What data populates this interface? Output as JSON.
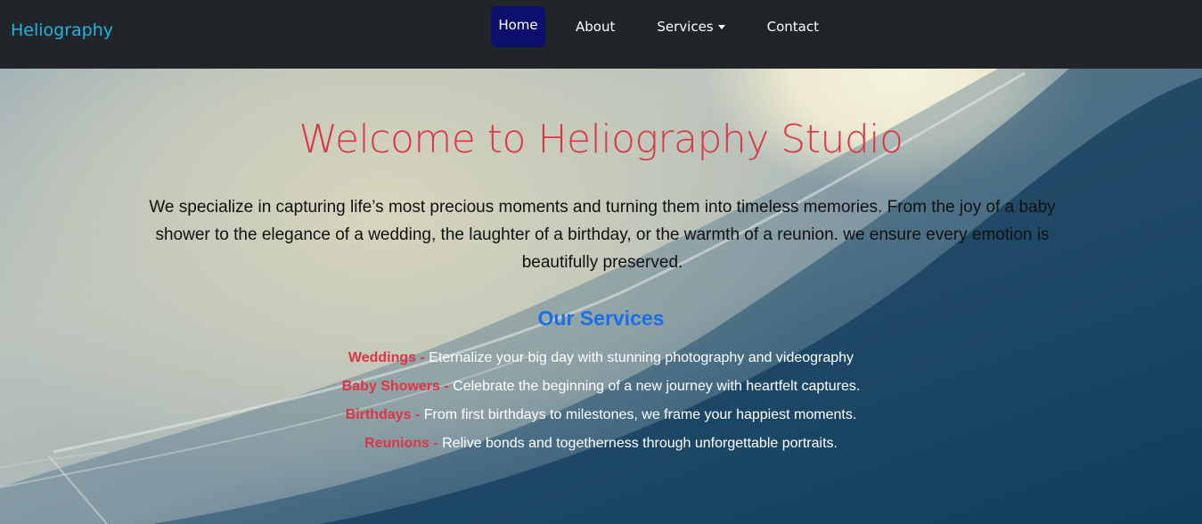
{
  "navbar": {
    "brand": "Heliography",
    "items": [
      {
        "label": "Home"
      },
      {
        "label": "About"
      },
      {
        "label": "Services"
      },
      {
        "label": "Contact"
      }
    ]
  },
  "hero": {
    "title": "Welcome to Heliography Studio",
    "intro": "We specialize in capturing life’s most precious moments and turning them into timeless memories. From the joy of a baby shower to the elegance of a wedding, the laughter of a birthday, or the warmth of a reunion. we ensure every emotion is beautifully preserved."
  },
  "services": {
    "heading": "Our Services",
    "items": [
      {
        "name": "Weddings - ",
        "description": "Eternalize your big day with stunning photography and videography"
      },
      {
        "name": "Baby Showers - ",
        "description": "Celebrate the beginning of a new journey with heartfelt captures."
      },
      {
        "name": "Birthdays - ",
        "description": "From first birthdays to milestones, we frame your happiest moments."
      },
      {
        "name": "Reunions - ",
        "description": "Relive bonds and togetherness through unforgettable portraits."
      }
    ]
  },
  "colors": {
    "navbar_bg": "#212529",
    "brand": "#1fb6e0",
    "active_nav_bg": "#0d0f6e",
    "title": "#dc3545",
    "services_heading": "#1a6fe8",
    "service_name": "#dc3545"
  }
}
